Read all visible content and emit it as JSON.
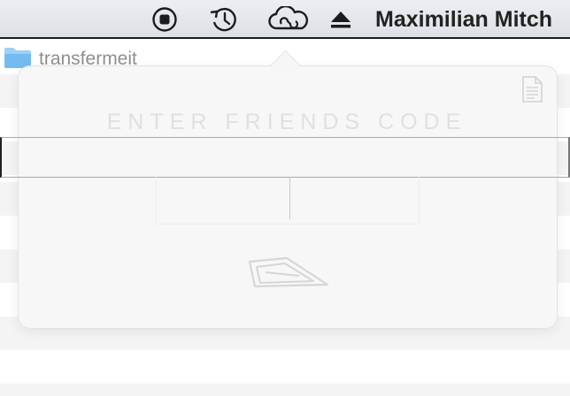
{
  "menubar": {
    "icons": [
      "stop-icon",
      "time-machine-icon",
      "creative-cloud-icon",
      "eject-icon"
    ],
    "user_name": "Maximilian Mitch"
  },
  "finder": {
    "folder_name": "transfermeit"
  },
  "popover": {
    "title": "ENTER FRIENDS CODE",
    "code_value": "",
    "icons": [
      "document-icon",
      "send-icon"
    ]
  }
}
